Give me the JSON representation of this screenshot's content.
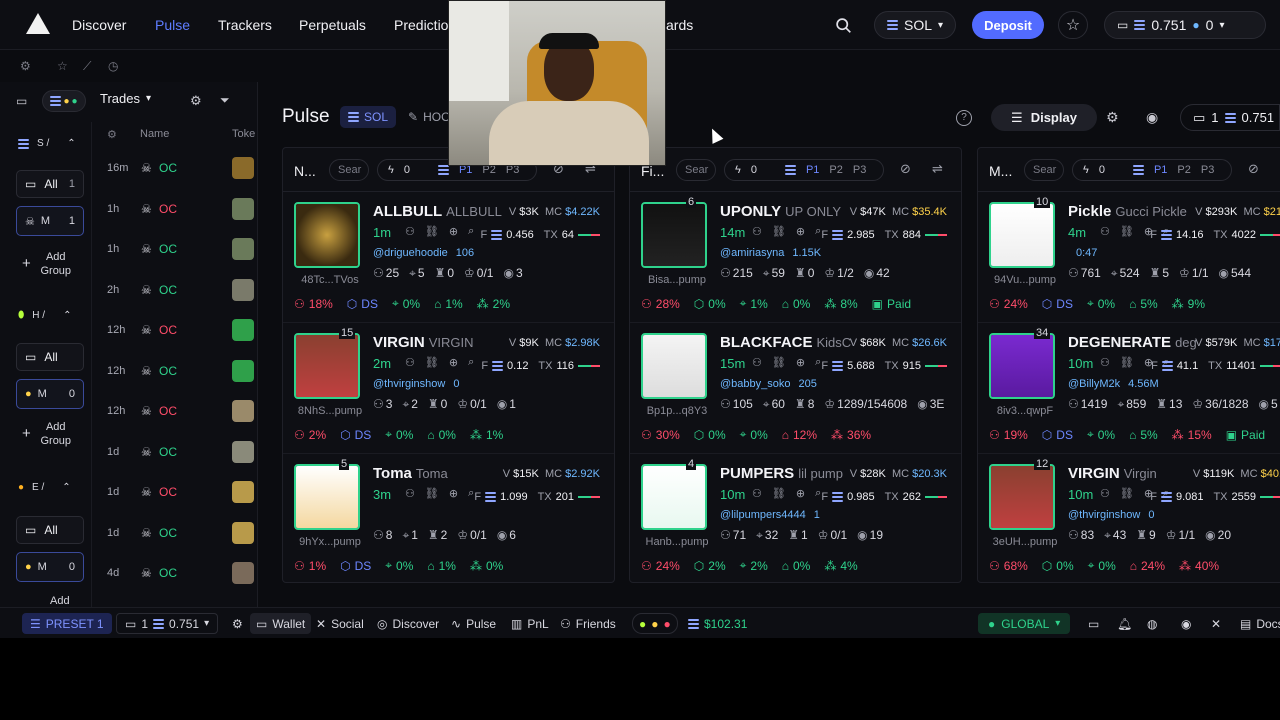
{
  "nav": {
    "links": [
      "Discover",
      "Pulse",
      "Trackers",
      "Perpetuals",
      "Predictio",
      "ards"
    ],
    "network": "SOL",
    "deposit": "Deposit",
    "wallet_balance": "0.751",
    "wallet_secondary": "0"
  },
  "left": {
    "trades_label": "Trades",
    "col_name": "Name",
    "col_token": "Toke",
    "groups": [
      {
        "head": "S /",
        "all": "All",
        "all_count": "1",
        "item": "M",
        "item_count": "1",
        "add": "Add Group"
      },
      {
        "head": "H /",
        "all": "All",
        "item": "M",
        "item_count": "0",
        "add": "Add Group"
      },
      {
        "head": "E /",
        "all": "All",
        "item": "M",
        "item_count": "0",
        "add": "Add"
      }
    ],
    "rows": [
      {
        "age": "16m",
        "name": "OC",
        "side": "buy"
      },
      {
        "age": "1h",
        "name": "OC",
        "side": "sell"
      },
      {
        "age": "1h",
        "name": "OC",
        "side": "buy"
      },
      {
        "age": "2h",
        "name": "OC",
        "side": "buy"
      },
      {
        "age": "12h",
        "name": "OC",
        "side": "sell"
      },
      {
        "age": "12h",
        "name": "OC",
        "side": "buy"
      },
      {
        "age": "12h",
        "name": "OC",
        "side": "sell"
      },
      {
        "age": "1d",
        "name": "OC",
        "side": "buy"
      },
      {
        "age": "1d",
        "name": "OC",
        "side": "sell"
      },
      {
        "age": "1d",
        "name": "OC",
        "side": "buy"
      },
      {
        "age": "4d",
        "name": "OC",
        "side": "buy"
      }
    ]
  },
  "main": {
    "title": "Pulse",
    "chip_sol": "SOL",
    "chip_hoo": "HOO",
    "display": "Display",
    "right_count": "1",
    "right_balance": "0.751",
    "columns": [
      {
        "name": "N...",
        "search": "Sear",
        "count": "0",
        "presets": [
          "P1",
          "P2",
          "P3"
        ],
        "cards": [
          {
            "count": "",
            "name": "ALLBULL",
            "sub": "ALLBULL",
            "age": "1m",
            "ca": "48Tc...TVos",
            "v": "$3K",
            "mc": "$4.22K",
            "mcclass": "mc",
            "f": "0.456",
            "tx": "64",
            "handle": "@driguehoodie",
            "followers": "106",
            "holders": "25",
            "snipers": "5",
            "insiders": "0",
            "bundles": "0/1",
            "views": "3",
            "p1": "18%",
            "p2": "DS",
            "p3": "0%",
            "p4": "1%",
            "p5": "2%",
            "p6": ""
          },
          {
            "count": "15",
            "name": "VIRGIN",
            "sub": "VIRGIN",
            "age": "2m",
            "ca": "8NhS...pump",
            "v": "$9K",
            "mc": "$2.98K",
            "mcclass": "mc",
            "f": "0.12",
            "tx": "116",
            "handle": "@thvirginshow",
            "followers": "0",
            "holders": "3",
            "snipers": "2",
            "insiders": "0",
            "bundles": "0/1",
            "views": "1",
            "p1": "2%",
            "p2": "DS",
            "p3": "0%",
            "p4": "0%",
            "p5": "1%",
            "p6": ""
          },
          {
            "count": "5",
            "name": "Toma",
            "sub": "Toma",
            "age": "3m",
            "ca": "9hYx...pump",
            "v": "$15K",
            "mc": "$2.92K",
            "mcclass": "mc",
            "f": "1.099",
            "tx": "201",
            "handle": "",
            "followers": "",
            "holders": "8",
            "snipers": "1",
            "insiders": "2",
            "bundles": "0/1",
            "views": "6",
            "p1": "1%",
            "p2": "DS",
            "p3": "0%",
            "p4": "1%",
            "p5": "0%",
            "p6": ""
          }
        ]
      },
      {
        "name": "Fi...",
        "search": "Sear",
        "count": "0",
        "presets": [
          "P1",
          "P2",
          "P3"
        ],
        "cards": [
          {
            "count": "6",
            "name": "UPONLY",
            "sub": "UP ONLY",
            "age": "14m",
            "ca": "Bisa...pump",
            "v": "$47K",
            "mc": "$35.4K",
            "mcclass": "mcy",
            "f": "2.985",
            "tx": "884",
            "handle": "@amiriasyna",
            "followers": "1.15K",
            "holders": "215",
            "snipers": "59",
            "insiders": "0",
            "bundles": "1/2",
            "views": "42",
            "p1": "28%",
            "p2": "0%",
            "p3": "1%",
            "p4": "0%",
            "p5": "8%",
            "p6": "Paid"
          },
          {
            "count": "",
            "name": "BLACKFACE",
            "sub": "KidsC",
            "age": "15m",
            "ca": "Bp1p...q8Y3",
            "v": "$68K",
            "mc": "$26.6K",
            "mcclass": "mc",
            "f": "5.688",
            "tx": "915",
            "handle": "@babby_soko",
            "followers": "205",
            "holders": "105",
            "snipers": "60",
            "insiders": "8",
            "bundles": "1289/154608",
            "views": "3E",
            "p1": "30%",
            "p2": "0%",
            "p3": "0%",
            "p4": "12%",
            "p5": "36%",
            "p6": ""
          },
          {
            "count": "4",
            "name": "PUMPERS",
            "sub": "lil pump",
            "age": "10m",
            "ca": "Hanb...pump",
            "v": "$28K",
            "mc": "$20.3K",
            "mcclass": "mc",
            "f": "0.985",
            "tx": "262",
            "handle": "@lilpumpers4444",
            "followers": "1",
            "holders": "71",
            "snipers": "32",
            "insiders": "1",
            "bundles": "0/1",
            "views": "19",
            "p1": "24%",
            "p2": "2%",
            "p3": "2%",
            "p4": "0%",
            "p5": "4%",
            "p6": ""
          }
        ]
      },
      {
        "name": "M...",
        "search": "Sear",
        "count": "0",
        "presets": [
          "P1",
          "P2",
          "P3"
        ],
        "cards": [
          {
            "count": "10",
            "name": "Pickle",
            "sub": "Gucci Pickle",
            "age": "4m",
            "ca": "94Vu...pump",
            "v": "$293K",
            "mc": "$21",
            "mcclass": "mcy",
            "f": "14.16",
            "tx": "4022",
            "handle": "",
            "followers": "0:47",
            "holders": "761",
            "snipers": "524",
            "insiders": "5",
            "bundles": "1/1",
            "views": "544",
            "p1": "24%",
            "p2": "DS",
            "p3": "0%",
            "p4": "5%",
            "p5": "9%",
            "p6": ""
          },
          {
            "count": "34",
            "name": "DEGENERATE",
            "sub": "deg",
            "age": "10m",
            "ca": "8iv3...qwpF",
            "v": "$579K",
            "mc": "$17",
            "mcclass": "mc",
            "f": "41.1",
            "tx": "11401",
            "handle": "@BillyM2k",
            "followers": "4.56M",
            "holders": "1419",
            "snipers": "859",
            "insiders": "13",
            "bundles": "36/1828",
            "views": "5",
            "p1": "19%",
            "p2": "DS",
            "p3": "0%",
            "p4": "5%",
            "p5": "15%",
            "p6": "Paid"
          },
          {
            "count": "12",
            "name": "VIRGIN",
            "sub": "Virgin",
            "age": "10m",
            "ca": "3eUH...pump",
            "v": "$119K",
            "mc": "$40.",
            "mcclass": "mcy",
            "f": "9.081",
            "tx": "2559",
            "handle": "@thvirginshow",
            "followers": "0",
            "holders": "83",
            "snipers": "43",
            "insiders": "9",
            "bundles": "1/1",
            "views": "20",
            "p1": "68%",
            "p2": "0%",
            "p3": "0%",
            "p4": "24%",
            "p5": "40%",
            "p6": ""
          }
        ]
      }
    ]
  },
  "bottom": {
    "preset": "PRESET 1",
    "wallets": "1",
    "balance": "0.751",
    "wallet": "Wallet",
    "social": "Social",
    "discover": "Discover",
    "pulse": "Pulse",
    "pnl": "PnL",
    "friends": "Friends",
    "sol_price": "$102.31",
    "region": "GLOBAL",
    "docs": "Docs"
  },
  "colors": {
    "accent": "#526bff",
    "green": "#2fd28c",
    "red": "#ff4d6a"
  }
}
